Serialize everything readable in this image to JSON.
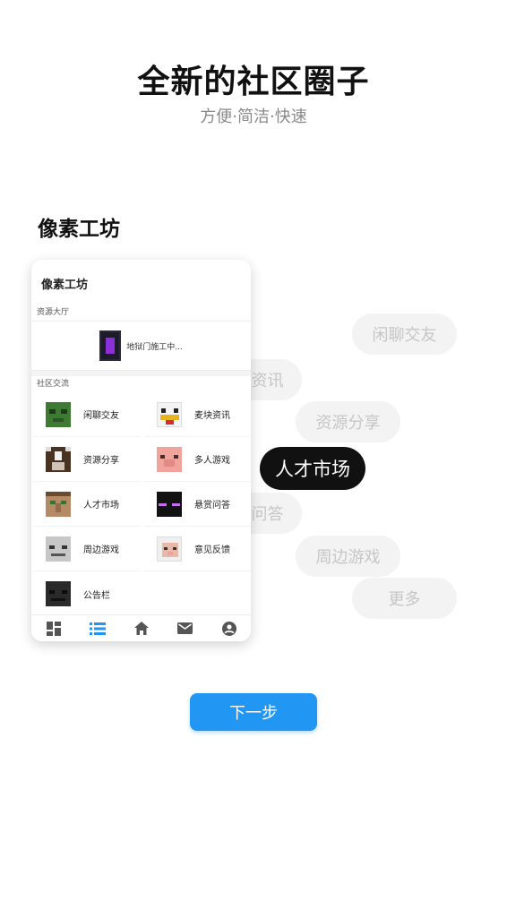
{
  "hero": {
    "title": "全新的社区圈子",
    "subtitle": "方便·简洁·快速"
  },
  "section_title": "像素工坊",
  "chips": [
    {
      "label": "闲聊交友",
      "active": false
    },
    {
      "label": "资讯",
      "active": false
    },
    {
      "label": "资源分享",
      "active": false
    },
    {
      "label": "人才市场",
      "active": true
    },
    {
      "label": "问答",
      "active": false
    },
    {
      "label": "周边游戏",
      "active": false
    },
    {
      "label": "更多",
      "active": false
    }
  ],
  "phone": {
    "header": "像素工坊",
    "resource_label": "资源大厅",
    "resource_item": "地狱门施工中...",
    "community_label": "社区交流",
    "grid": [
      {
        "label": "闲聊交友",
        "icon": "zombie-icon"
      },
      {
        "label": "麦块资讯",
        "icon": "chicken-icon"
      },
      {
        "label": "资源分享",
        "icon": "cow-icon"
      },
      {
        "label": "多人游戏",
        "icon": "pig-icon"
      },
      {
        "label": "人才市场",
        "icon": "villager-icon"
      },
      {
        "label": "悬赏问答",
        "icon": "enderman-icon"
      },
      {
        "label": "周边游戏",
        "icon": "skeleton-icon"
      },
      {
        "label": "意见反馈",
        "icon": "sheep-icon"
      },
      {
        "label": "公告栏",
        "icon": "wither-skeleton-icon"
      }
    ],
    "tabs": [
      {
        "icon": "dashboard-icon",
        "active": false
      },
      {
        "icon": "list-icon",
        "active": true
      },
      {
        "icon": "home-icon",
        "active": false
      },
      {
        "icon": "mail-icon",
        "active": false
      },
      {
        "icon": "account-icon",
        "active": false
      }
    ]
  },
  "next_button": "下一步",
  "colors": {
    "accent": "#2196f3",
    "chip_bg": "#f3f3f3",
    "chip_text": "#c6c6c6",
    "active_chip": "#111111"
  }
}
